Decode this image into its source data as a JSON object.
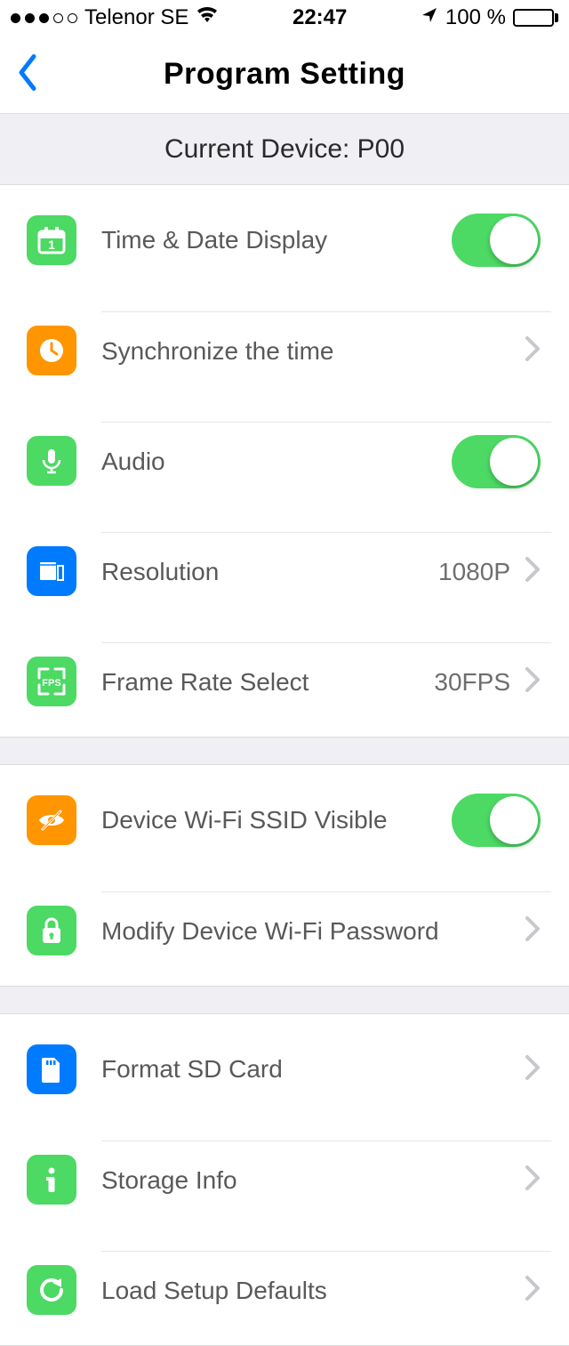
{
  "status_bar": {
    "carrier": "Telenor SE",
    "time": "22:47",
    "battery_text": "100 %"
  },
  "nav": {
    "title": "Program Setting"
  },
  "device_header": "Current Device: P00",
  "settings": {
    "time_date_display": {
      "label": "Time & Date Display",
      "on": true
    },
    "sync_time": {
      "label": "Synchronize the time"
    },
    "audio": {
      "label": "Audio",
      "on": true
    },
    "resolution": {
      "label": "Resolution",
      "value": "1080P"
    },
    "frame_rate": {
      "label": "Frame Rate Select",
      "value": "30FPS"
    },
    "wifi_ssid_visible": {
      "label": "Device Wi-Fi SSID Visible",
      "on": true
    },
    "modify_wifi_pwd": {
      "label": "Modify Device Wi-Fi Password"
    },
    "format_sd": {
      "label": "Format SD Card"
    },
    "storage_info": {
      "label": "Storage Info"
    },
    "load_defaults": {
      "label": "Load Setup Defaults"
    }
  }
}
